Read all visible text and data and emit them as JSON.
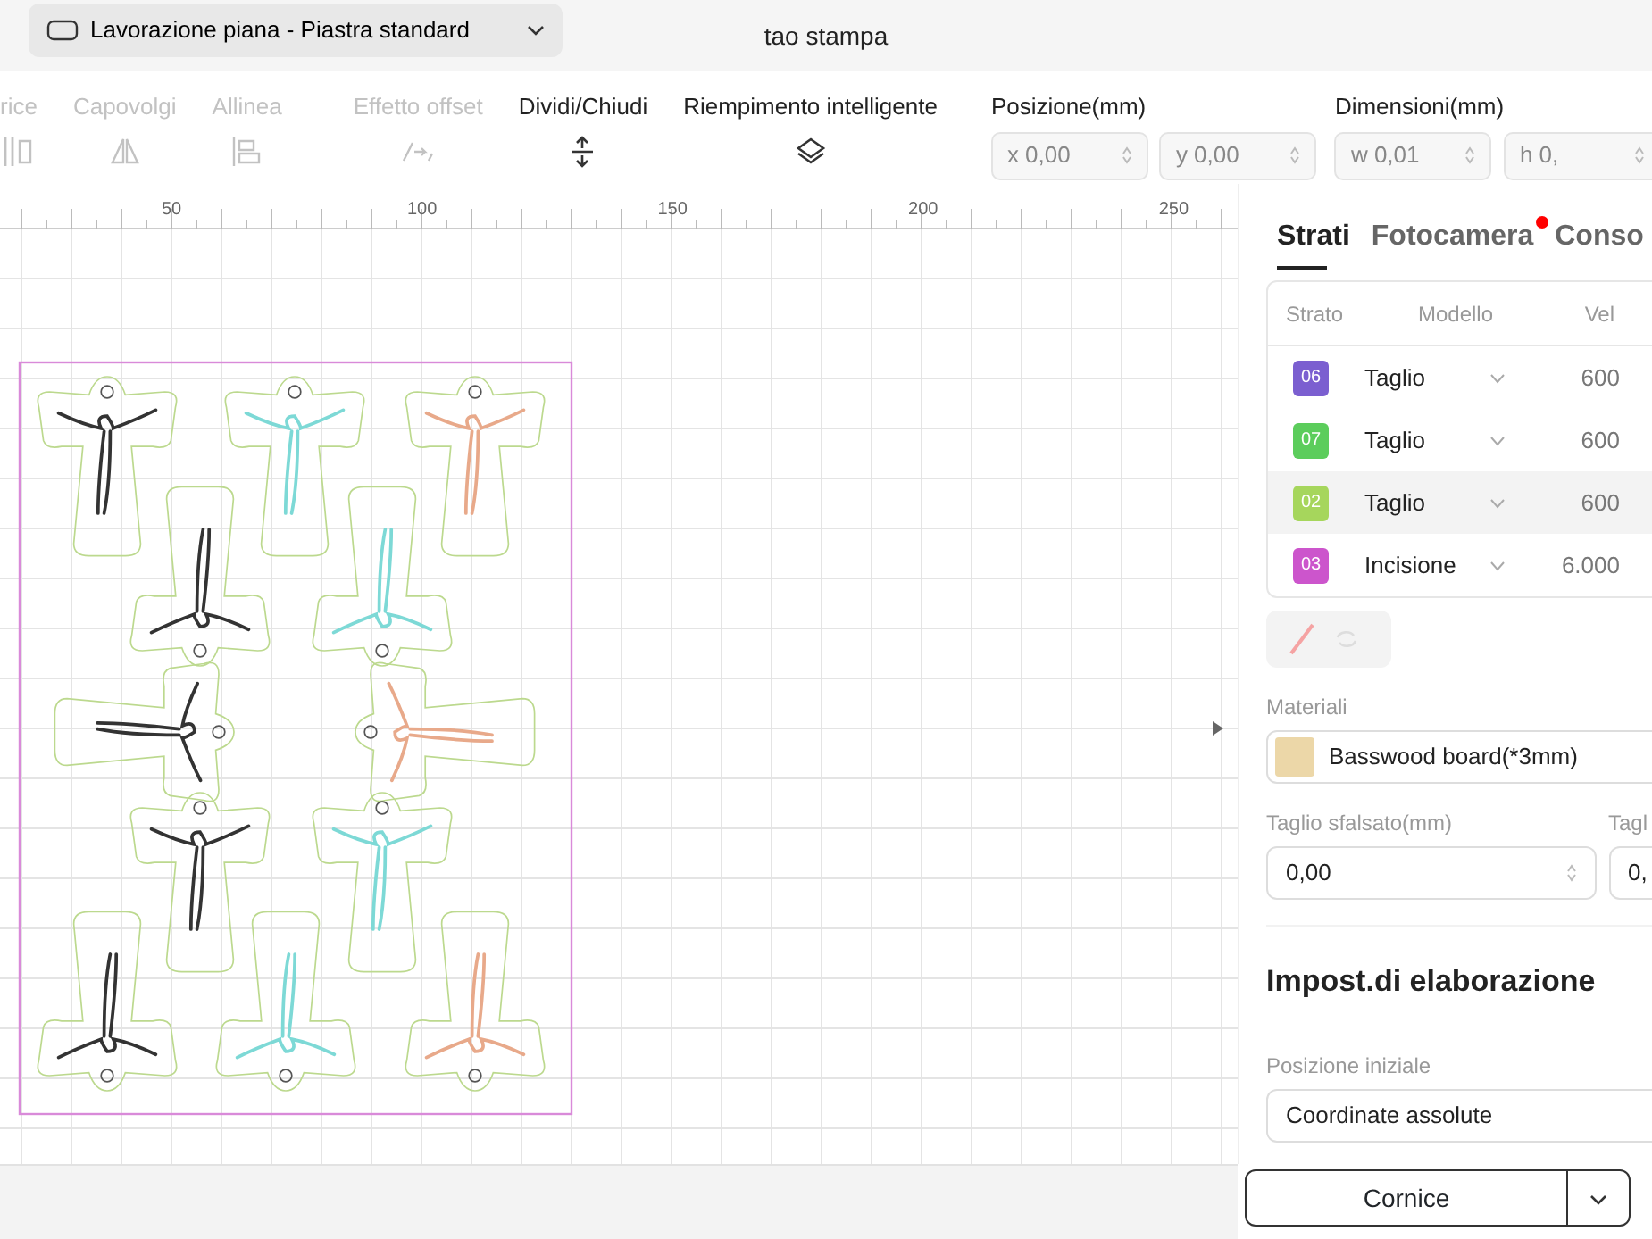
{
  "window": {
    "title": "tao stampa"
  },
  "workspace": {
    "label": "Lavorazione piana - Piastra standard"
  },
  "tools": [
    {
      "label": "rice",
      "disabled": true,
      "kind": "matrix"
    },
    {
      "label": "Capovolgi",
      "disabled": true,
      "kind": "flip"
    },
    {
      "label": "Allinea",
      "disabled": true,
      "kind": "align"
    },
    {
      "label": "Effetto offset",
      "disabled": true,
      "kind": "offset"
    },
    {
      "label": "Dividi/Chiudi",
      "disabled": false,
      "kind": "split"
    },
    {
      "label": "Riempimento intelligente",
      "disabled": false,
      "kind": "fill"
    }
  ],
  "position": {
    "label": "Posizione(mm)",
    "fields": [
      "x 0,00",
      "y 0,00"
    ]
  },
  "size": {
    "label": "Dimensioni(mm)",
    "fields": [
      "w 0,01",
      "h 0,"
    ]
  },
  "ruler": {
    "ticks": [
      "50",
      "100",
      "150",
      "200",
      "250"
    ]
  },
  "panel": {
    "tabs": [
      {
        "label": "Strati",
        "selected": true,
        "dot": false
      },
      {
        "label": "Fotocamera",
        "selected": false,
        "dot": true
      },
      {
        "label": "Conso",
        "selected": false,
        "dot": false
      }
    ],
    "columns": [
      "Strato",
      "Modello",
      "Vel"
    ],
    "layers": [
      {
        "number": "06",
        "color": "#7b5fd0",
        "mode": "Taglio",
        "speed": "600",
        "selected": false
      },
      {
        "number": "07",
        "color": "#5ccd5c",
        "mode": "Taglio",
        "speed": "600",
        "selected": false
      },
      {
        "number": "02",
        "color": "#a6d65c",
        "mode": "Taglio",
        "speed": "600",
        "selected": true
      },
      {
        "number": "03",
        "color": "#cc55cc",
        "mode": "Incisione",
        "speed": "6.000",
        "selected": false
      }
    ],
    "material": {
      "label": "Materiali",
      "value": "Basswood board(*3mm)"
    },
    "offset_fields": [
      {
        "label": "Taglio sfalsato(mm)",
        "value": "0,00"
      },
      {
        "label": "Tagl",
        "value": "0,"
      }
    ],
    "section_title": "Impost.di elaborazione",
    "start": {
      "label": "Posizione iniziale",
      "value": "Coordinate assolute"
    },
    "frame_button": "Cornice"
  }
}
